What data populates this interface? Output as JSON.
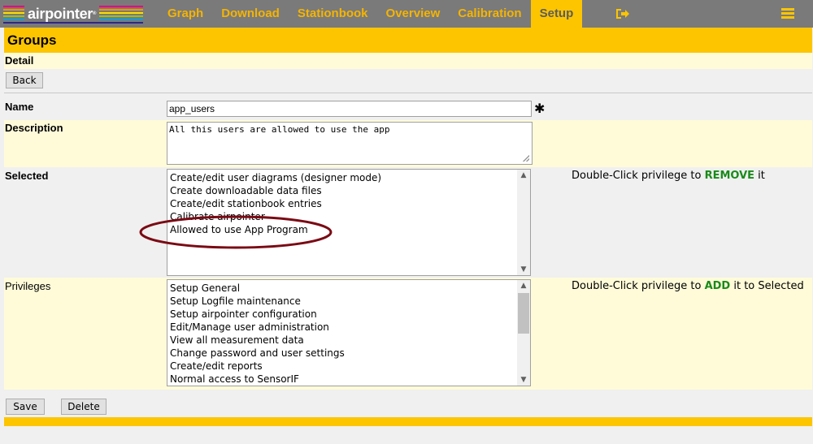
{
  "app": {
    "logo_text": "airpointer",
    "logo_stripe_colors": [
      "#e6007e",
      "#f39200",
      "#ffde00",
      "#95c11f",
      "#009fe3",
      "#312783"
    ],
    "nav": [
      "Graph",
      "Download",
      "Stationbook",
      "Overview",
      "Calibration",
      "Setup"
    ],
    "active_nav": "Setup",
    "logout_icon": "logout-icon",
    "menu_icon": "hamburger-menu-icon",
    "accent": "#fdc500"
  },
  "page": {
    "title": "Groups",
    "section": "Detail",
    "back_label": "Back"
  },
  "form": {
    "name_label": "Name",
    "name_value": "app_users",
    "required_mark": "✱",
    "description_label": "Description",
    "description_value": "All this users are allowed to use the app",
    "selected_label": "Selected",
    "selected_items": [
      "Create/edit user diagrams (designer mode)",
      "Create downloadable data files",
      "Create/edit stationbook entries",
      "Calibrate airpointer",
      "Allowed to use App Program"
    ],
    "selected_hint_prefix": "Double-Click privilege to ",
    "selected_hint_action": "REMOVE",
    "selected_hint_suffix": " it",
    "privileges_label": "Privileges",
    "privilege_items": [
      "Setup General",
      "Setup Logfile maintenance",
      "Setup airpointer configuration",
      "Edit/Manage user administration",
      "View all measurement data",
      "Change password and user settings",
      "Create/edit reports",
      "Normal access to SensorIF"
    ],
    "privileges_hint_prefix": "Double-Click privilege to ",
    "privileges_hint_action": "ADD",
    "privileges_hint_suffix": " it to Selected",
    "annotation_color": "#7a0a14"
  },
  "actions": {
    "save_label": "Save",
    "delete_label": "Delete"
  }
}
